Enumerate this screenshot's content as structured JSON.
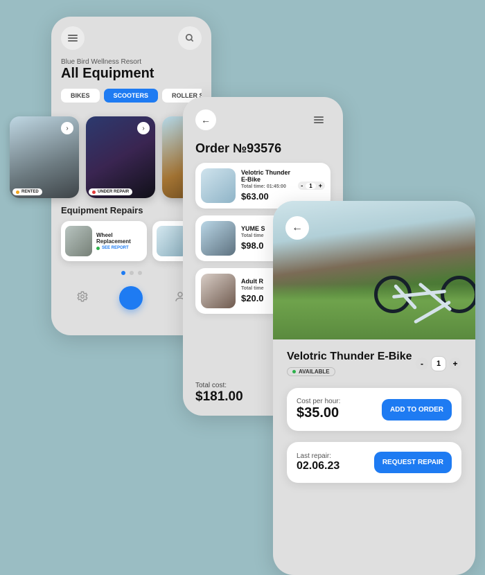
{
  "phoneA": {
    "resort": "Blue Bird Wellness Resort",
    "title": "All Equipment",
    "tabs": {
      "bikes": "BIKES",
      "scooters": "SCOOTERS",
      "roller": "ROLLER SK"
    },
    "cards": {
      "c1_status": "RENTED",
      "c2_status": "UNDER REPAIR"
    },
    "repairs_heading": "Equipment Repairs",
    "repair1_name": "Wheel Replacement",
    "repair1_link": "SEE REPORT"
  },
  "phoneB": {
    "title": "Order №93576",
    "items": [
      {
        "name": "Velotric Thunder E-Bike",
        "time": "Total time: 01:45:00",
        "price": "$63.00",
        "qty": "1"
      },
      {
        "name": "YUME S",
        "time": "Total time",
        "price": "$98.0",
        "qty": ""
      },
      {
        "name": "Adult R",
        "time": "Total time",
        "price": "$20.0",
        "qty": ""
      }
    ],
    "total_label": "Total cost:",
    "total_value": "$181.00"
  },
  "phoneC": {
    "name": "Velotric Thunder E-Bike",
    "status": "AVAILABLE",
    "qty": "1",
    "cost_label": "Cost per hour:",
    "cost_value": "$35.00",
    "add_btn": "ADD TO ORDER",
    "repair_label": "Last repair:",
    "repair_value": "02.06.23",
    "repair_btn": "REQUEST REPAIR"
  }
}
